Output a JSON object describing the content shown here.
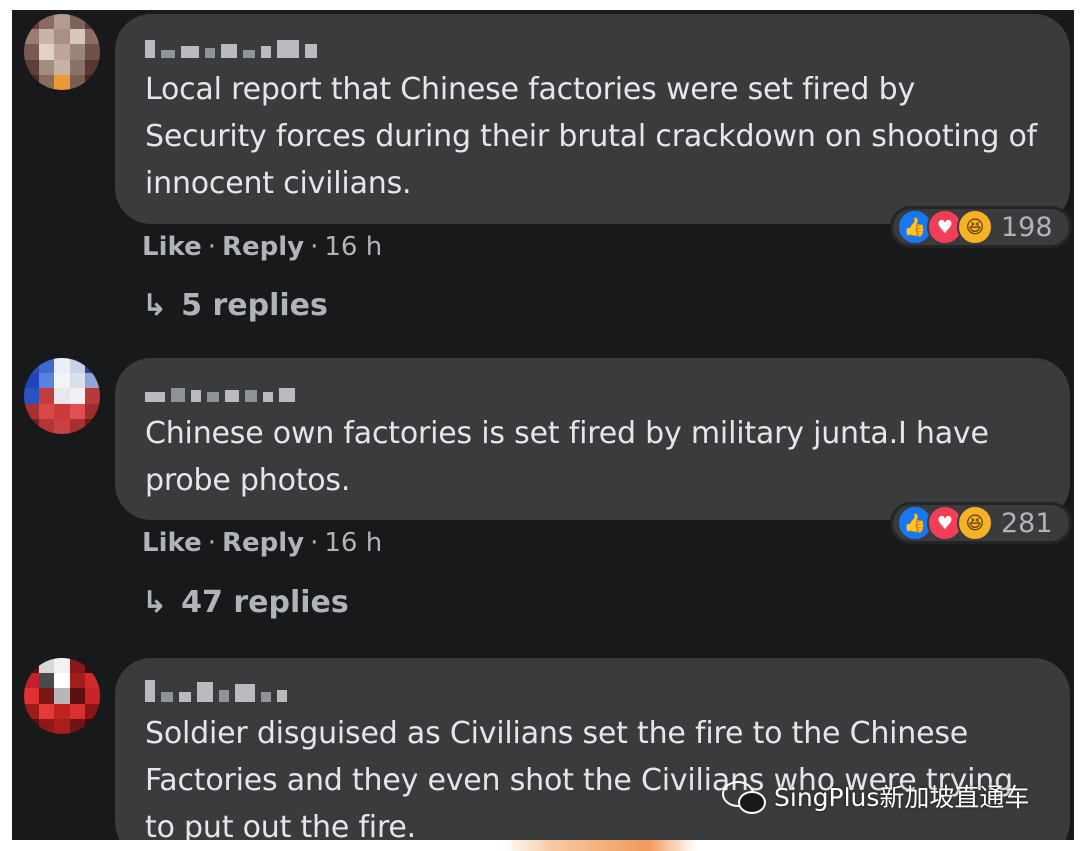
{
  "comments": [
    {
      "text": "Local report that Chinese factories were set fired by Security forces during their brutal crackdown on shooting of innocent civilians.",
      "reaction_count": "198",
      "actions": {
        "like": "Like",
        "reply": "Reply",
        "time": "16 h",
        "dot": "·"
      },
      "replies_label": "5 replies"
    },
    {
      "text": "Chinese own factories is set fired by military junta.I have probe photos.",
      "reaction_count": "281",
      "actions": {
        "like": "Like",
        "reply": "Reply",
        "time": "16 h",
        "dot": "·"
      },
      "replies_label": "47 replies"
    },
    {
      "text": "Soldier disguised as Civilians set the fire to the Chinese Factories and they even shot the Civilians who were trying to put out the fire."
    }
  ],
  "reactions": {
    "icons": [
      "like-icon",
      "love-icon",
      "haha-icon"
    ],
    "colors": {
      "like": "#1877f2",
      "love": "#f33e58",
      "haha": "#f7b125"
    }
  },
  "reply_arrow": "↳",
  "watermark": {
    "text": "SingPlus新加坡直通车",
    "icon": "wechat-icon"
  },
  "theme": {
    "background": "#18191a",
    "bubble": "#3a3b3c",
    "text": "#e4e6eb",
    "muted": "#b0b3b8"
  }
}
